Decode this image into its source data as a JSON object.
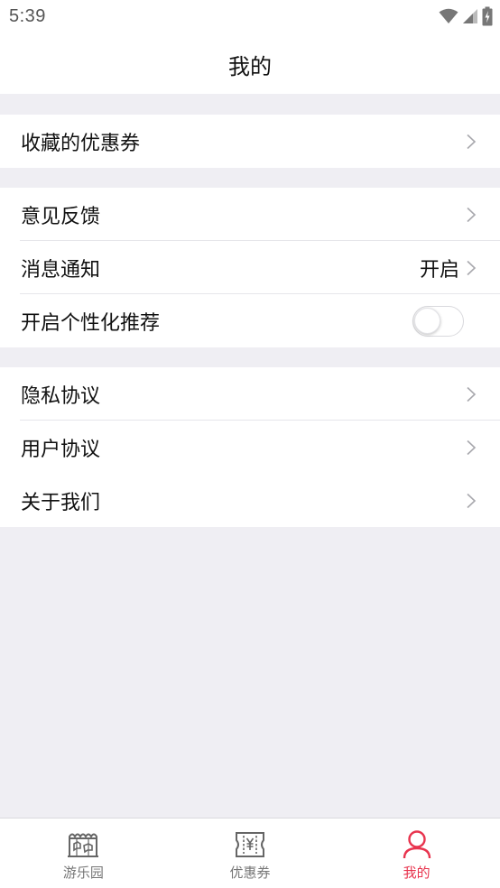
{
  "status_bar": {
    "time": "5:39"
  },
  "header": {
    "title": "我的"
  },
  "groups": [
    {
      "rows": [
        {
          "label": "收藏的优惠券"
        }
      ]
    },
    {
      "rows": [
        {
          "label": "意见反馈"
        },
        {
          "label": "消息通知",
          "value": "开启"
        },
        {
          "label": "开启个性化推荐",
          "toggle": false
        }
      ]
    },
    {
      "rows": [
        {
          "label": "隐私协议"
        },
        {
          "label": "用户协议"
        },
        {
          "label": "关于我们"
        }
      ]
    }
  ],
  "tab_bar": {
    "tabs": [
      {
        "label": "游乐园",
        "icon": "carousel-icon"
      },
      {
        "label": "优惠券",
        "icon": "coupon-icon"
      },
      {
        "label": "我的",
        "icon": "user-icon",
        "active": true
      }
    ]
  },
  "colors": {
    "accent": "#E8344E",
    "background": "#EFEEF3",
    "tab_inactive": "#777777"
  }
}
